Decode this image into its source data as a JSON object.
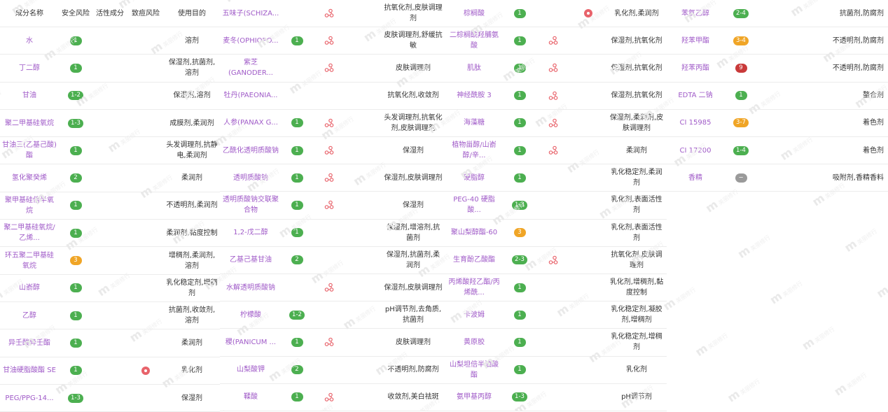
{
  "headers": {
    "name": "成分名称",
    "safety": "安全风险",
    "active": "活性成分",
    "acne": "致痘风险",
    "purpose": "使用目的"
  },
  "icons": {
    "molecule": "molecule-icon",
    "acne": "acne-risk-icon",
    "minus": "minus-icon"
  },
  "colors": {
    "name": "#a05bc8",
    "green": "#4caf50",
    "orange": "#f0a526",
    "red": "#c93a3a",
    "acne": "#e8636b",
    "gray": "#9a9a9a"
  },
  "col1": [
    {
      "name": "水",
      "safety": "1",
      "purpose": "溶剂"
    },
    {
      "name": "丁二醇",
      "safety": "1",
      "purpose": "保湿剂,抗菌剂,溶剂"
    },
    {
      "name": "甘油",
      "safety": "1-2",
      "purpose": "保湿剂,溶剂"
    },
    {
      "name": "聚二甲基硅氧烷",
      "safety": "1-3",
      "purpose": "成膜剂,柔润剂"
    },
    {
      "name": "甘油三(乙基己酸)酯",
      "safety": "1",
      "purpose": "头发调理剂,抗静电,柔润剂"
    },
    {
      "name": "氢化聚癸烯",
      "safety": "2",
      "purpose": "柔润剂"
    },
    {
      "name": "聚甲基硅倍半氧烷",
      "safety": "1",
      "purpose": "不透明剂,柔润剂"
    },
    {
      "name": "聚二甲基硅氧烷/乙烯...",
      "safety": "1",
      "purpose": "柔润剂,黏度控制"
    },
    {
      "name": "环五聚二甲基硅氧烷",
      "safety": "3",
      "purpose": "增稠剂,柔润剂,溶剂"
    },
    {
      "name": "山嵛醇",
      "safety": "1",
      "purpose": "乳化稳定剂,增稠剂"
    },
    {
      "name": "乙醇",
      "safety": "1",
      "purpose": "抗菌剂,收敛剂,溶剂"
    },
    {
      "name": "异壬酸异壬酯",
      "safety": "1",
      "purpose": "柔润剂"
    },
    {
      "name": "甘油硬脂酸酯 SE",
      "safety": "1",
      "acne": true,
      "purpose": "乳化剂"
    },
    {
      "name": "PEG/PPG-14...",
      "safety": "1-3",
      "purpose": "保湿剂"
    }
  ],
  "col2": [
    {
      "name": "五味子(SCHIZA...",
      "safety": "",
      "molecule": true,
      "purpose": "抗氧化剂,皮肤调理剂"
    },
    {
      "name": "麦冬(OPHIOPO...",
      "safety": "1",
      "molecule": true,
      "purpose": "皮肤调理剂,舒缓抗敏"
    },
    {
      "name": "紫芝(GANODER...",
      "safety": "",
      "molecule": true,
      "purpose": "皮肤调理剂"
    },
    {
      "name": "牡丹(PAEONIA...",
      "safety": "",
      "molecule": false,
      "purpose": "抗氧化剂,收敛剂"
    },
    {
      "name": "人参(PANAX G...",
      "safety": "1",
      "molecule": true,
      "purpose": "头发调理剂,抗氧化剂,皮肤调理剂"
    },
    {
      "name": "乙酰化透明质酸钠",
      "safety": "1",
      "molecule": true,
      "purpose": "保湿剂"
    },
    {
      "name": "透明质酸钠",
      "safety": "1",
      "molecule": true,
      "purpose": "保湿剂,皮肤调理剂"
    },
    {
      "name": "透明质酸钠交联聚合物",
      "safety": "1",
      "molecule": true,
      "purpose": "保湿剂"
    },
    {
      "name": "1,2-戊二醇",
      "safety": "1",
      "molecule": false,
      "purpose": "保湿剂,增溶剂,抗菌剂"
    },
    {
      "name": "乙基己基甘油",
      "safety": "2",
      "molecule": false,
      "purpose": "保湿剂,抗菌剂,柔润剂"
    },
    {
      "name": "水解透明质酸钠",
      "safety": "",
      "molecule": true,
      "purpose": "保湿剂,皮肤调理剂"
    },
    {
      "name": "柠檬酸",
      "safety": "1-2",
      "molecule": false,
      "purpose": "pH调节剂,去角质,抗菌剂"
    },
    {
      "name": "稷(PANICUM ...",
      "safety": "1",
      "molecule": true,
      "purpose": "皮肤调理剂"
    },
    {
      "name": "山梨酸钾",
      "safety": "2",
      "molecule": false,
      "purpose": "不透明剂,防腐剂"
    },
    {
      "name": "鞣酸",
      "safety": "1",
      "molecule": true,
      "purpose": "收敛剂,美白祛斑"
    }
  ],
  "col3": [
    {
      "name": "棕榈酸",
      "safety": "1",
      "molecule": false,
      "acne": true,
      "purpose": "乳化剂,柔润剂"
    },
    {
      "name": "二棕榈酰羟脯氨酸",
      "safety": "1",
      "molecule": true,
      "acne": false,
      "purpose": "保湿剂,抗氧化剂"
    },
    {
      "name": "肌肽",
      "safety": "1",
      "molecule": true,
      "acne": false,
      "purpose": "保湿剂,抗氧化剂"
    },
    {
      "name": "神经酰胺 3",
      "safety": "1",
      "molecule": true,
      "acne": false,
      "purpose": "保湿剂,抗氧化剂"
    },
    {
      "name": "海藻糖",
      "safety": "1",
      "molecule": true,
      "acne": false,
      "purpose": "保湿剂,柔润剂,皮肤调理剂"
    },
    {
      "name": "植物甾醇/山嵛醇/辛...",
      "safety": "1",
      "molecule": true,
      "acne": false,
      "purpose": "柔润剂"
    },
    {
      "name": "硬脂醇",
      "safety": "1",
      "molecule": false,
      "acne": false,
      "purpose": "乳化稳定剂,柔润剂"
    },
    {
      "name": "PEG-40 硬脂酸...",
      "safety": "1-3",
      "molecule": false,
      "acne": false,
      "purpose": "乳化剂,表面活性剂"
    },
    {
      "name": "聚山梨醇酯-60",
      "safety": "3",
      "molecule": false,
      "acne": false,
      "purpose": "乳化剂,表面活性剂"
    },
    {
      "name": "生育酚乙酸酯",
      "safety": "2-3",
      "molecule": true,
      "acne": false,
      "purpose": "抗氧化剂,皮肤调理剂"
    },
    {
      "name": "丙烯酸羟乙酯/丙烯酰...",
      "safety": "1",
      "molecule": false,
      "acne": false,
      "purpose": "乳化剂,增稠剂,黏度控制"
    },
    {
      "name": "卡波姆",
      "safety": "1",
      "molecule": false,
      "acne": false,
      "purpose": "乳化稳定剂,凝胶剂,增稠剂"
    },
    {
      "name": "黄原胶",
      "safety": "1",
      "molecule": false,
      "acne": false,
      "purpose": "乳化稳定剂,增稠剂"
    },
    {
      "name": "山梨坦倍半油酸酯",
      "safety": "1",
      "molecule": false,
      "acne": false,
      "purpose": "乳化剂"
    },
    {
      "name": "氨甲基丙醇",
      "safety": "1-3",
      "molecule": false,
      "acne": false,
      "purpose": "pH调节剂"
    }
  ],
  "col4": [
    {
      "name": "苯氧乙醇",
      "safety": "2-4",
      "purpose": "抗菌剂,防腐剂"
    },
    {
      "name": "羟苯甲酯",
      "safety": "3-4",
      "purpose": "不透明剂,防腐剂"
    },
    {
      "name": "羟苯丙酯",
      "safety": "9",
      "purpose": "不透明剂,防腐剂"
    },
    {
      "name": "EDTA 二钠",
      "safety": "1",
      "purpose": "螯合剂"
    },
    {
      "name": "CI 15985",
      "safety": "3-7",
      "purpose": "着色剂"
    },
    {
      "name": "CI 17200",
      "safety": "1-4",
      "purpose": "着色剂"
    },
    {
      "name": "香精",
      "safety": "minus",
      "purpose": "吸附剂,香精香料"
    }
  ]
}
